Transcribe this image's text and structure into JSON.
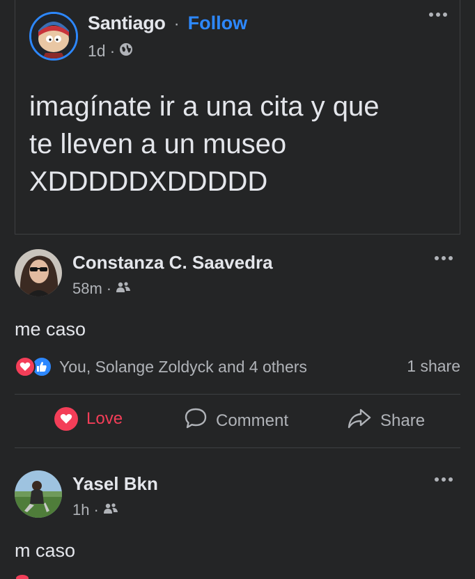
{
  "shared_post": {
    "author": "Santiago",
    "separator": "·",
    "follow_label": "Follow",
    "time": "1d",
    "meta_sep": "·",
    "text_lines": [
      "imagínate ir a una cita y que",
      "te lleven a un museo",
      "XDDDDDXDDDDD"
    ]
  },
  "comments": [
    {
      "name": "Constanza C. Saavedra",
      "time": "58m",
      "meta_sep": "·",
      "text": "me caso",
      "reactions": "You, Solange Zoldyck and 4 others",
      "shares": "1 share"
    },
    {
      "name": "Yasel Bkn",
      "time": "1h",
      "meta_sep": "·",
      "text": "m caso"
    }
  ],
  "actions": {
    "love": "Love",
    "comment": "Comment",
    "share": "Share"
  },
  "icons": [
    "more-options-icon",
    "globe-icon",
    "friends-icon",
    "love-reaction-icon",
    "like-reaction-icon",
    "comment-icon",
    "share-arrow-icon"
  ],
  "colors": {
    "background": "#242526",
    "accent_blue": "#2d88ff",
    "love_red": "#f33e58",
    "secondary_text": "#b0b3b8"
  }
}
